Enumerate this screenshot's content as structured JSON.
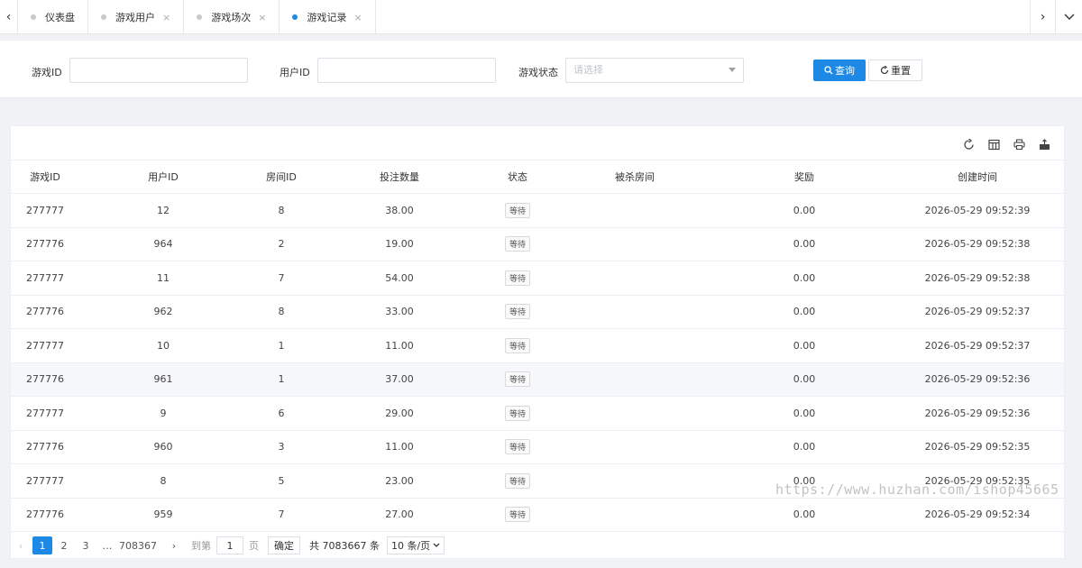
{
  "tabbar": {
    "tabs": [
      {
        "label": "仪表盘",
        "closable": false,
        "active": false
      },
      {
        "label": "游戏用户",
        "closable": true,
        "active": false
      },
      {
        "label": "游戏场次",
        "closable": true,
        "active": false
      },
      {
        "label": "游戏记录",
        "closable": true,
        "active": true
      }
    ],
    "left_arrow": "‹",
    "right_arrow": "›",
    "down_arrow": "⌄",
    "close_glyph": "×"
  },
  "search": {
    "game_id_label": "游戏ID",
    "game_id_value": "",
    "user_id_label": "用户ID",
    "user_id_value": "",
    "status_label": "游戏状态",
    "status_placeholder": "请选择",
    "query_button": "查询",
    "reset_button": "重置"
  },
  "table": {
    "columns": [
      "游戏ID",
      "用户ID",
      "房间ID",
      "投注数量",
      "状态",
      "被杀房间",
      "奖励",
      "创建时间"
    ],
    "rows": [
      {
        "game_id": "277777",
        "user_id": "12",
        "room_id": "8",
        "bet": "38.00",
        "status": "等待",
        "killed_room": "",
        "reward": "0.00",
        "created": "2026-05-29 09:52:39"
      },
      {
        "game_id": "277776",
        "user_id": "964",
        "room_id": "2",
        "bet": "19.00",
        "status": "等待",
        "killed_room": "",
        "reward": "0.00",
        "created": "2026-05-29 09:52:38"
      },
      {
        "game_id": "277777",
        "user_id": "11",
        "room_id": "7",
        "bet": "54.00",
        "status": "等待",
        "killed_room": "",
        "reward": "0.00",
        "created": "2026-05-29 09:52:38"
      },
      {
        "game_id": "277776",
        "user_id": "962",
        "room_id": "8",
        "bet": "33.00",
        "status": "等待",
        "killed_room": "",
        "reward": "0.00",
        "created": "2026-05-29 09:52:37"
      },
      {
        "game_id": "277777",
        "user_id": "10",
        "room_id": "1",
        "bet": "11.00",
        "status": "等待",
        "killed_room": "",
        "reward": "0.00",
        "created": "2026-05-29 09:52:37"
      },
      {
        "game_id": "277776",
        "user_id": "961",
        "room_id": "1",
        "bet": "37.00",
        "status": "等待",
        "killed_room": "",
        "reward": "0.00",
        "created": "2026-05-29 09:52:36"
      },
      {
        "game_id": "277777",
        "user_id": "9",
        "room_id": "6",
        "bet": "29.00",
        "status": "等待",
        "killed_room": "",
        "reward": "0.00",
        "created": "2026-05-29 09:52:36"
      },
      {
        "game_id": "277776",
        "user_id": "960",
        "room_id": "3",
        "bet": "11.00",
        "status": "等待",
        "killed_room": "",
        "reward": "0.00",
        "created": "2026-05-29 09:52:35"
      },
      {
        "game_id": "277777",
        "user_id": "8",
        "room_id": "5",
        "bet": "23.00",
        "status": "等待",
        "killed_room": "",
        "reward": "0.00",
        "created": "2026-05-29 09:52:35"
      },
      {
        "game_id": "277776",
        "user_id": "959",
        "room_id": "7",
        "bet": "27.00",
        "status": "等待",
        "killed_room": "",
        "reward": "0.00",
        "created": "2026-05-29 09:52:34"
      }
    ],
    "highlighted_row": 5
  },
  "toolbar": {
    "icons": [
      "refresh-icon",
      "columns-icon",
      "print-icon",
      "export-icon"
    ]
  },
  "pagination": {
    "prev": "‹",
    "pages": [
      "1",
      "2",
      "3"
    ],
    "current": "1",
    "ellipsis": "…",
    "last_page": "708367",
    "next": "›",
    "goto_label": "到第",
    "goto_value": "1",
    "page_unit": "页",
    "confirm": "确定",
    "total": "共 7083667 条",
    "page_size": "10 条/页"
  },
  "watermark": "https://www.huzhan.com/ishop45665",
  "colors": {
    "primary": "#1e88e5",
    "border": "#ebeef5",
    "page_bg": "#f0f2f5"
  }
}
